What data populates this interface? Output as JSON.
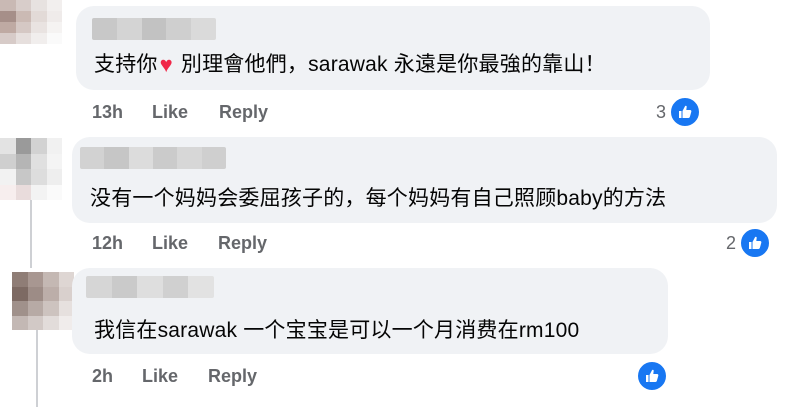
{
  "comments": [
    {
      "text_before_heart": "支持你",
      "text_after_heart": " 別理會他們，sarawak 永遠是你最強的靠山！",
      "time": "13h",
      "like_label": "Like",
      "reply_label": "Reply",
      "reaction_count": "3"
    },
    {
      "text": "没有一个妈妈会委屈孩子的，每个妈妈有自己照顾baby的方法",
      "time": "12h",
      "like_label": "Like",
      "reply_label": "Reply",
      "reaction_count": "2"
    },
    {
      "text": "我信在sarawak 一个宝宝是可以一个月消费在rm100",
      "time": "2h",
      "like_label": "Like",
      "reply_label": "Reply",
      "reaction_count": ""
    }
  ],
  "icons": {
    "heart": "♥",
    "reaction": "thumbs-up-icon"
  },
  "colors": {
    "bubble": "#f0f2f5",
    "like_blue": "#1877f2",
    "heart_red": "#f02849",
    "meta_gray": "#65676b"
  }
}
